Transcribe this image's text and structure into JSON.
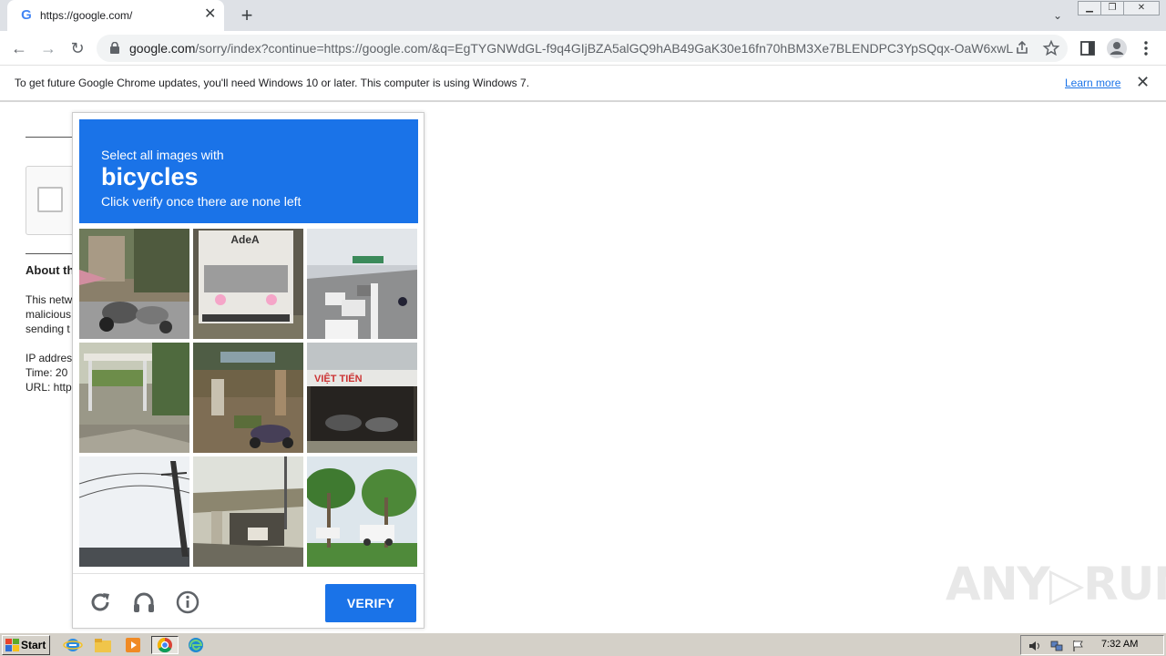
{
  "browser": {
    "tab_title": "https://google.com/",
    "favicon_letter": "G",
    "close_glyph": "✕",
    "new_tab_glyph": "+",
    "tab_search_glyph": "⌄",
    "url_host": "google.com",
    "url_rest": "/sorry/index?continue=https://google.com/&q=EgTYGNWdGL-f9q4GIjBZA5alGQ9hAB49GaK30e16fn70hBM3Xe7BLENDPC3YpSQqx-OaW6xwL...",
    "back_glyph": "←",
    "forward_glyph": "→",
    "reload_glyph": "↻",
    "icons": [
      "lock-icon",
      "share-icon",
      "star-icon",
      "sidepanel-icon",
      "profile-icon",
      "menu-icon"
    ]
  },
  "infobar": {
    "message": "To get future Google Chrome updates, you'll need Windows 10 or later. This computer is using Windows 7.",
    "link": "Learn more",
    "close": "✕"
  },
  "background_page": {
    "heading": "About th",
    "para_lines": [
      "This netw",
      "malicious",
      "sending t"
    ],
    "info_lines": [
      "IP addres",
      "Time: 20",
      "URL: http"
    ]
  },
  "challenge": {
    "line1": "Select all images with",
    "keyword": "bicycles",
    "line3": "Click verify once there are none left",
    "verify_label": "VERIFY",
    "tiles": [
      "street-motorbikes",
      "truck-adea",
      "highway-traffic",
      "roadside-hedge",
      "market-scooters",
      "shop-viet-tien",
      "utility-pole",
      "overpass-bridge",
      "palm-park"
    ],
    "tile_sign_text": "AdeA",
    "shop_sign_text": "VIỆT TIẾN",
    "footer_icons": [
      "reload-icon",
      "audio-icon",
      "info-icon"
    ]
  },
  "watermark": "ANY▷RUN",
  "taskbar": {
    "start_label": "Start",
    "clock": "7:32 AM",
    "pinned": [
      "ie-icon",
      "explorer-icon",
      "media-player-icon",
      "chrome-icon",
      "edge-icon"
    ]
  },
  "colors": {
    "accent": "#1a73e8",
    "taskbar": "#d4d0c8",
    "tabstrip": "#dee1e6"
  }
}
